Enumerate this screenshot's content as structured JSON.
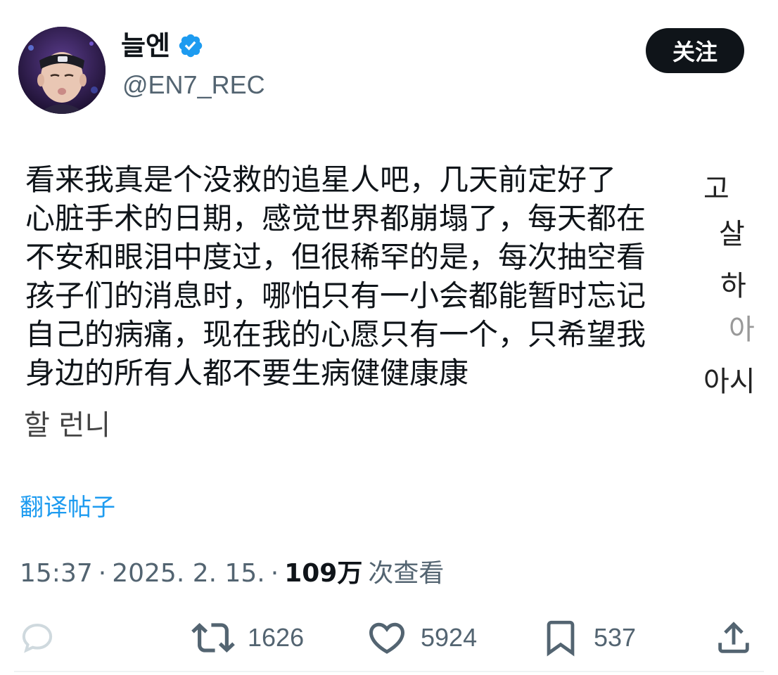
{
  "author": {
    "display_name": "늘엔",
    "handle": "@EN7_REC",
    "verified": true
  },
  "follow_button": {
    "label": "关注"
  },
  "tweet": {
    "lines": [
      "看来我真是个没救的追星人吧，几天前定好了",
      "心脏手术的日期，感觉世界都崩塌了，每天都在",
      "不安和眼泪中度过，但很稀罕的是，每次抽空看",
      "孩子们的消息时，哪怕只有一小会都能暂时忘记",
      "自己的病痛，现在我的心愿只有一个，只希望我",
      "身边的所有人都不要生病健健康康"
    ],
    "ghost_korean": [
      "고",
      "살",
      "하",
      "아",
      "아시",
      "할 런니"
    ]
  },
  "translate_link": "翻译帖子",
  "meta": {
    "time": "15:37",
    "date": "2025. 2. 15.",
    "views": "109万",
    "views_label": "次查看",
    "separator": "·"
  },
  "actions": {
    "reply": {
      "icon": "reply-icon",
      "count": ""
    },
    "retweet": {
      "icon": "retweet-icon",
      "count": "1626"
    },
    "like": {
      "icon": "heart-icon",
      "count": "5924"
    },
    "bookmark": {
      "icon": "bookmark-icon",
      "count": "537"
    },
    "share": {
      "icon": "share-icon"
    }
  },
  "colors": {
    "text": "#0f1419",
    "secondary": "#536471",
    "link": "#1d9bf0",
    "verified": "#1d9bf0",
    "button_bg": "#0f1419"
  }
}
